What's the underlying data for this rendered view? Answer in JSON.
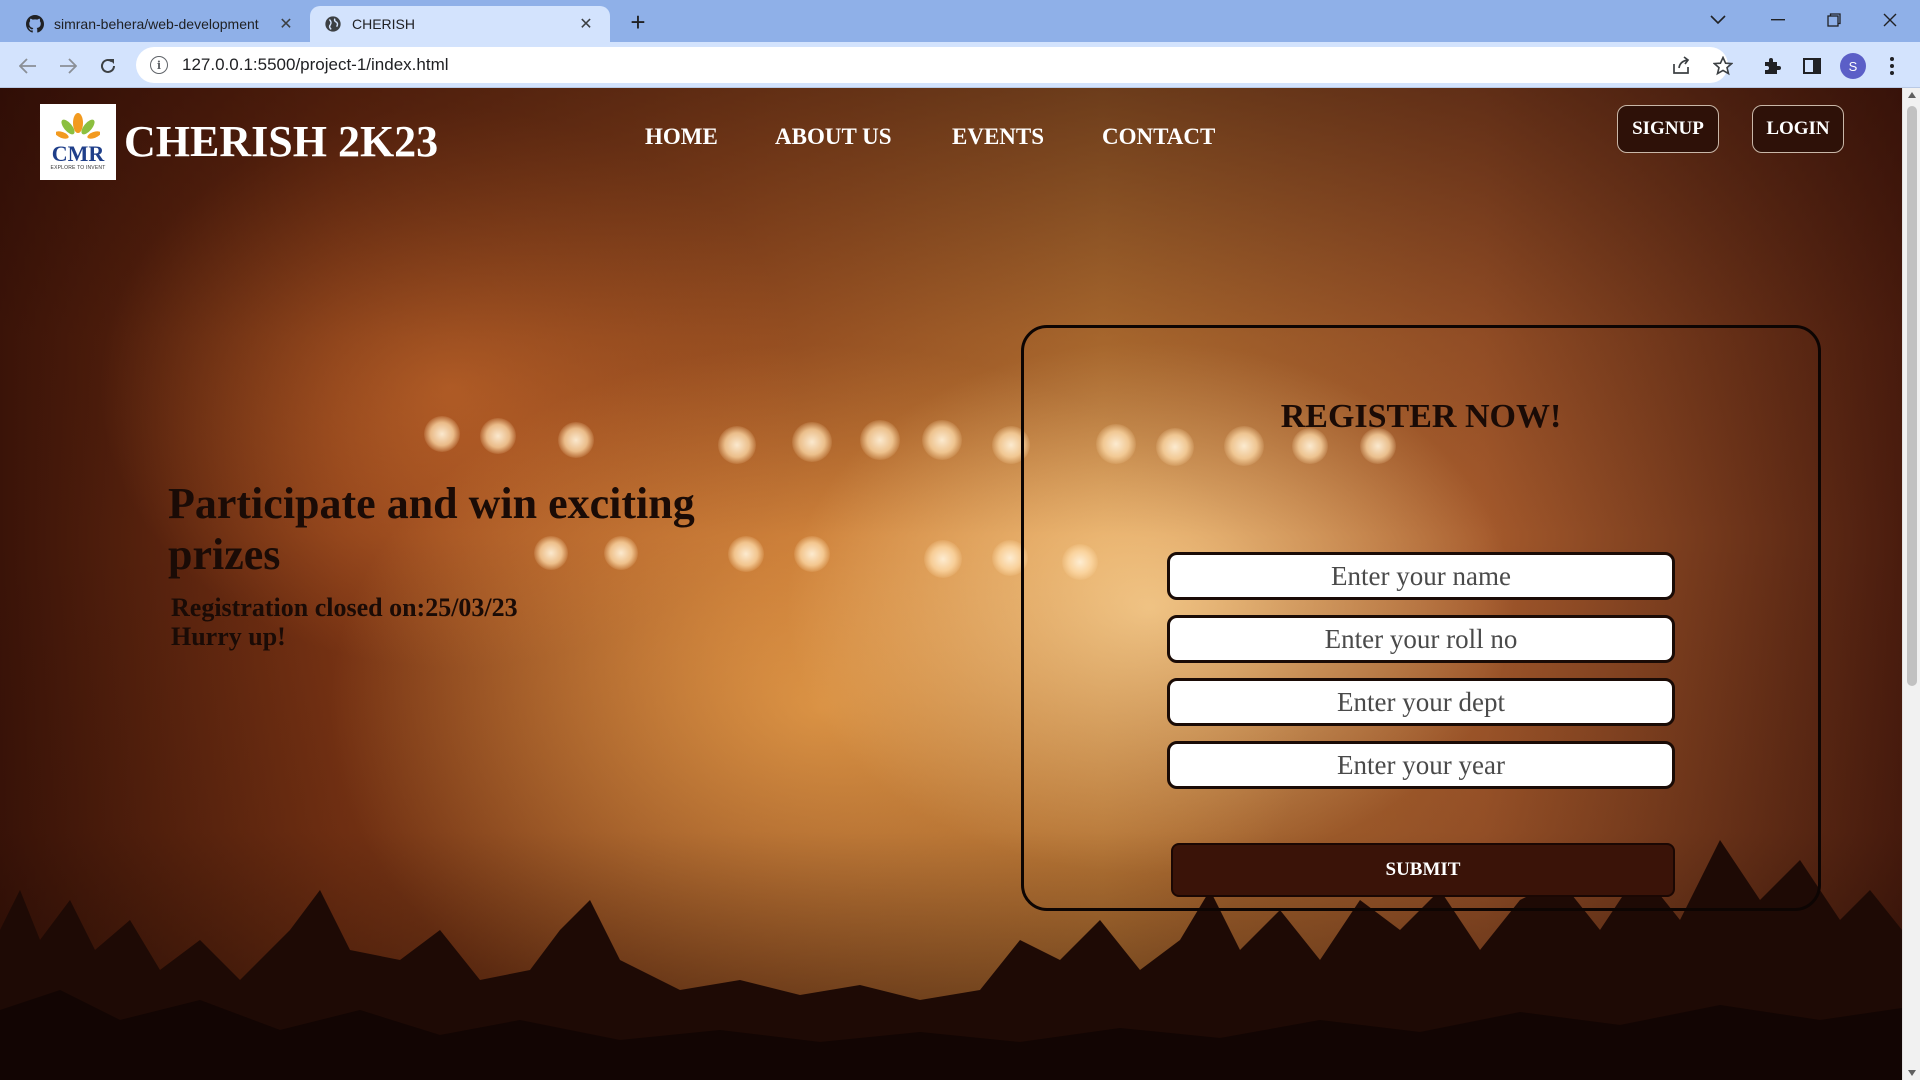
{
  "browser": {
    "tabs": [
      {
        "title": "simran-behera/web-development",
        "icon": "github-icon",
        "active": false
      },
      {
        "title": "CHERISH",
        "icon": "globe-icon",
        "active": true
      }
    ],
    "url": "127.0.0.1:5500/project-1/index.html",
    "profile_initial": "S"
  },
  "site": {
    "logo": {
      "text": "CMR",
      "tagline": "EXPLORE TO INVENT"
    },
    "brand": "CHERISH 2K23",
    "nav": [
      "HOME",
      "ABOUT US",
      "EVENTS",
      "CONTACT"
    ],
    "signup_label": "SIGNUP",
    "login_label": "LOGIN"
  },
  "hero": {
    "title": "Participate and win exciting prizes",
    "registration_line": "Registration closed on:25/03/23",
    "hurry_line": "Hurry up!"
  },
  "register": {
    "heading": "REGISTER NOW!",
    "fields": [
      {
        "placeholder": "Enter your name",
        "value": ""
      },
      {
        "placeholder": "Enter your roll no",
        "value": ""
      },
      {
        "placeholder": "Enter your dept",
        "value": ""
      },
      {
        "placeholder": "Enter your year",
        "value": ""
      }
    ],
    "submit_label": "SUBMIT"
  },
  "colors": {
    "tabbar": "#8fb0e8",
    "toolbar": "#d3e3fd",
    "header_button": "#2e1108",
    "submit_button": "#3a1308",
    "text_dark": "#1a0b06"
  }
}
